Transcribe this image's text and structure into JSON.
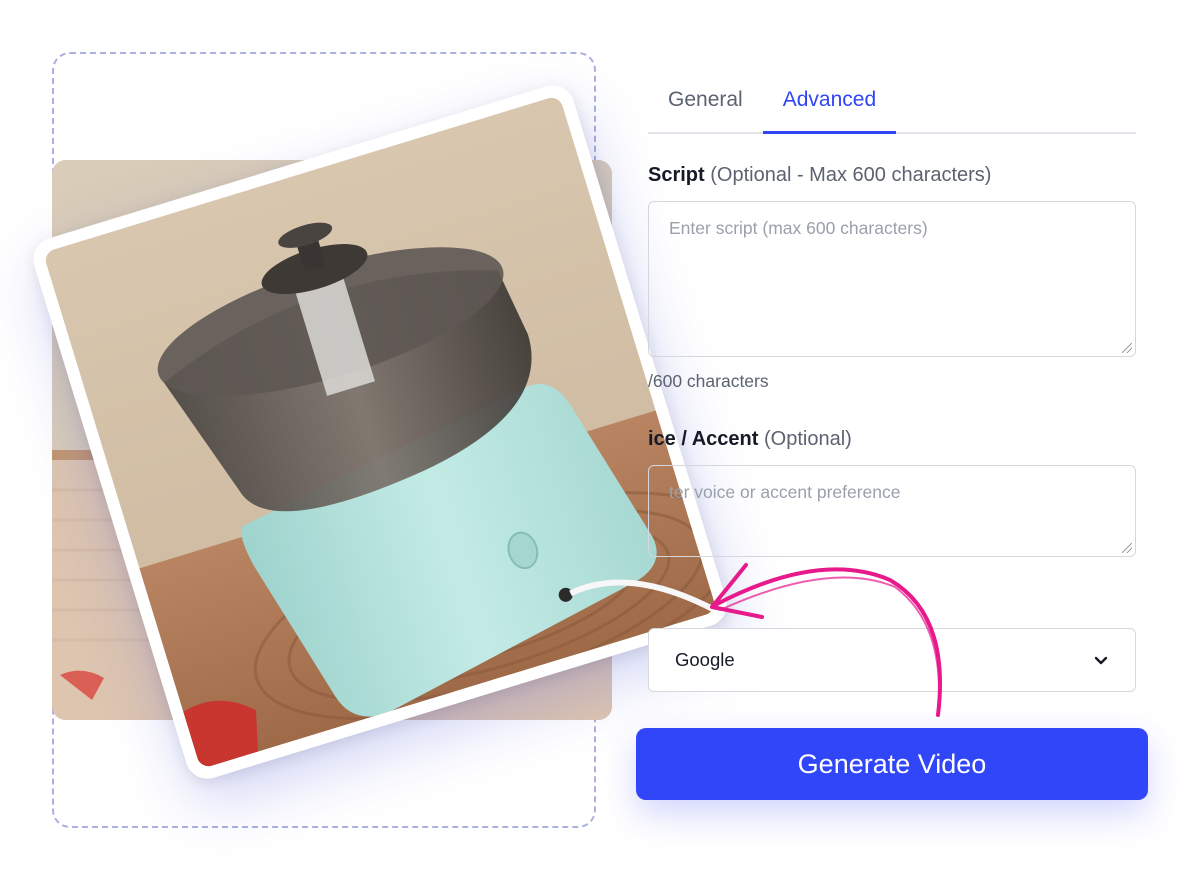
{
  "tabs": {
    "general_label": "General",
    "advanced_label": "Advanced",
    "active": "Advanced"
  },
  "script": {
    "label": "Script",
    "label_hint": "(Optional - Max 600 characters)",
    "placeholder": "Enter script (max 600 characters)",
    "counter": "/600 characters"
  },
  "voice": {
    "label": "ice / Accent",
    "label_hint": "(Optional)",
    "placeholder": "ter voice or accent preference"
  },
  "provider": {
    "selected": "Google"
  },
  "actions": {
    "generate_label": "Generate Video"
  },
  "colors": {
    "accent": "#3046f8",
    "annotation_arrow": "#e8198b",
    "appliance_base": "#b8e3de"
  },
  "icons": {
    "select_chevron": "chevron-down-icon",
    "annotation": "curved-arrow-icon"
  }
}
